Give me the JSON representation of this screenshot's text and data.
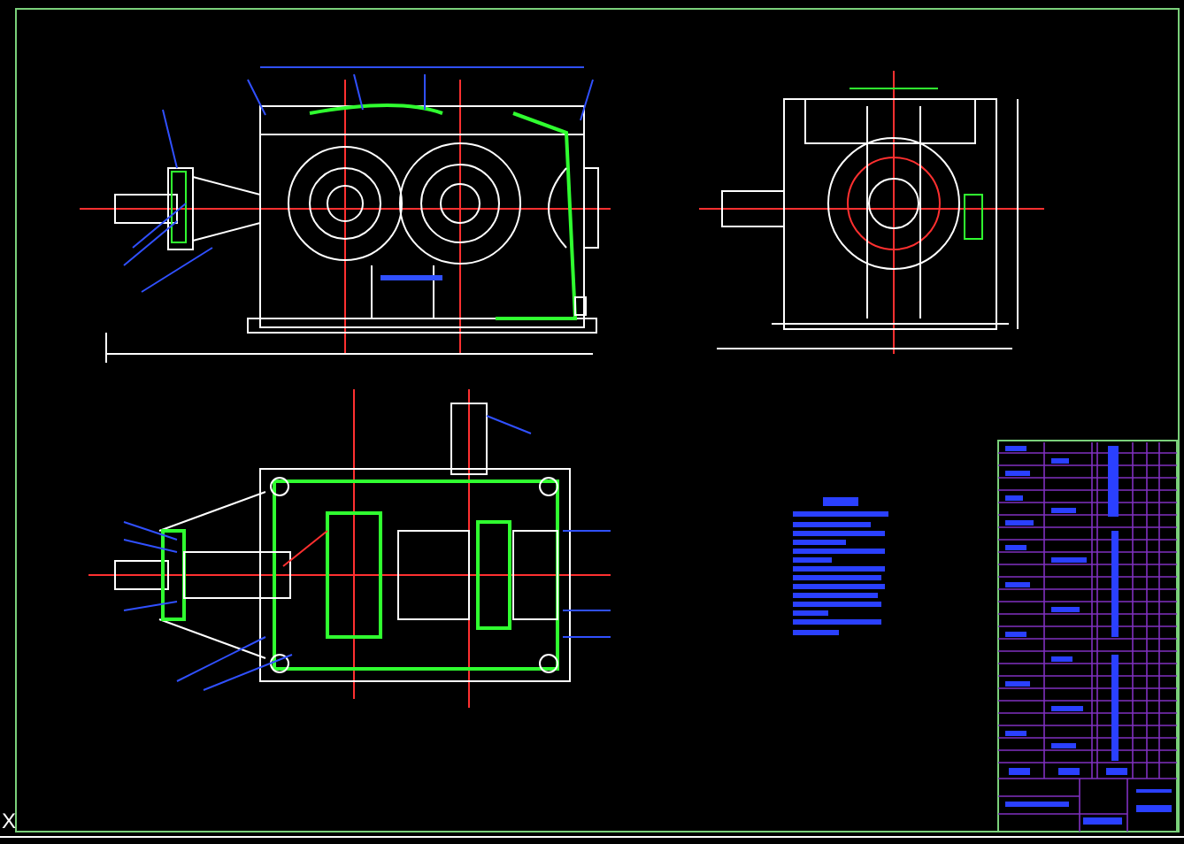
{
  "ucs_icon": {
    "axis_label": "X"
  }
}
